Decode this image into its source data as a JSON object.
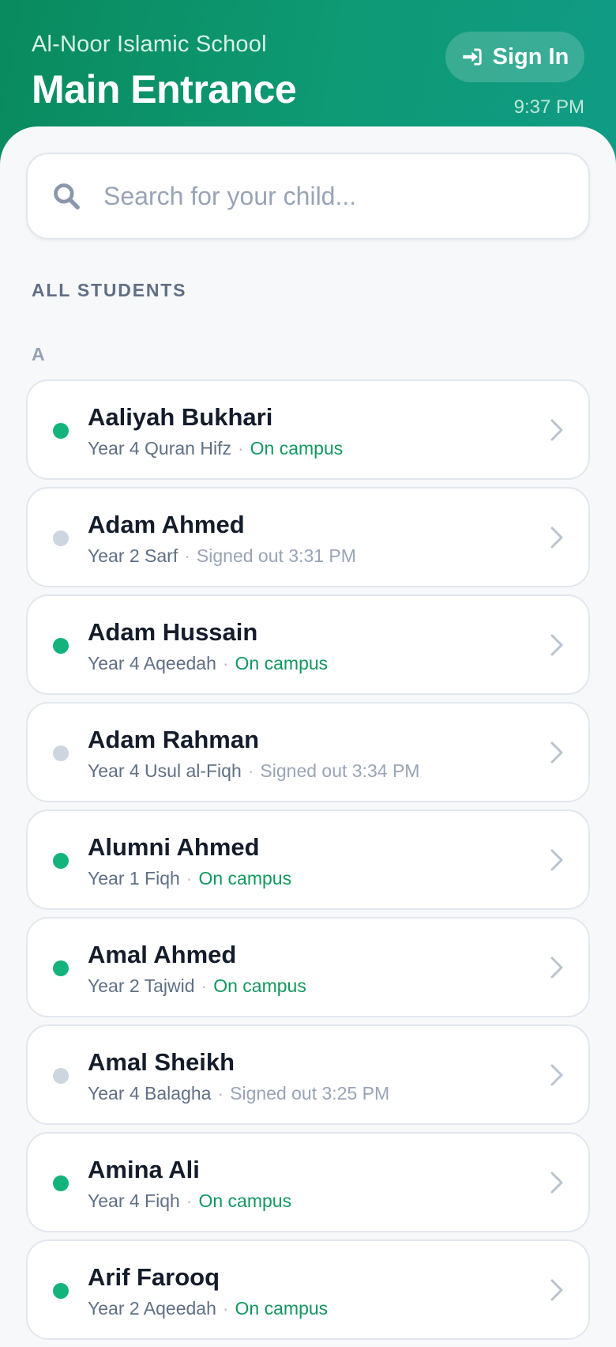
{
  "header": {
    "school_name": "Al-Noor Islamic School",
    "title": "Main Entrance",
    "signin_label": "Sign In",
    "time": "9:37 PM"
  },
  "search": {
    "placeholder": "Search for your child...",
    "value": ""
  },
  "section_label": "ALL STUDENTS",
  "group_letter": "A",
  "separator": "·",
  "students": [
    {
      "name": "Aaliyah Bukhari",
      "class": "Year 4 Quran Hifz",
      "status": "On campus",
      "on_campus": true
    },
    {
      "name": "Adam Ahmed",
      "class": "Year 2 Sarf",
      "status": "Signed out 3:31 PM",
      "on_campus": false
    },
    {
      "name": "Adam Hussain",
      "class": "Year 4 Aqeedah",
      "status": "On campus",
      "on_campus": true
    },
    {
      "name": "Adam Rahman",
      "class": "Year 4 Usul al-Fiqh",
      "status": "Signed out 3:34 PM",
      "on_campus": false
    },
    {
      "name": "Alumni Ahmed",
      "class": "Year 1 Fiqh",
      "status": "On campus",
      "on_campus": true
    },
    {
      "name": "Amal Ahmed",
      "class": "Year 2 Tajwid",
      "status": "On campus",
      "on_campus": true
    },
    {
      "name": "Amal Sheikh",
      "class": "Year 4 Balagha",
      "status": "Signed out 3:25 PM",
      "on_campus": false
    },
    {
      "name": "Amina Ali",
      "class": "Year 4 Fiqh",
      "status": "On campus",
      "on_campus": true
    },
    {
      "name": "Arif Farooq",
      "class": "Year 2 Aqeedah",
      "status": "On campus",
      "on_campus": true
    }
  ],
  "colors": {
    "header_start": "#0a8a5e",
    "header_end": "#109b86",
    "on_campus": "#14b37c",
    "signed_out": "#cdd5e1"
  },
  "icons": {
    "signin": "sign-in-icon",
    "search": "search-icon",
    "chevron": "chevron-right-icon"
  }
}
